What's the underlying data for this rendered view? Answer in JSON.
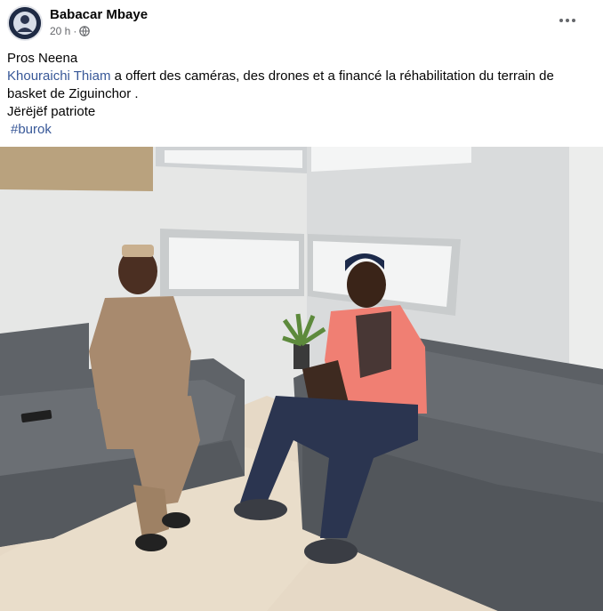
{
  "post": {
    "author": "Babacar Mbaye",
    "timestamp": "20 h",
    "separator": "·",
    "audience_icon": "globe-icon",
    "more_icon": "ellipsis-icon",
    "text": {
      "line1": "Pros Neena",
      "mention": "Khouraichi Thiam",
      "line2_rest": "  a offert des caméras, des drones et a financé la réhabilitation du terrain de basket de Ziguinchor .",
      "line3": "Jërëjëf  patriote",
      "hashtag": "#burok"
    }
  },
  "colors": {
    "link": "#385898",
    "secondary_text": "#65676b"
  }
}
